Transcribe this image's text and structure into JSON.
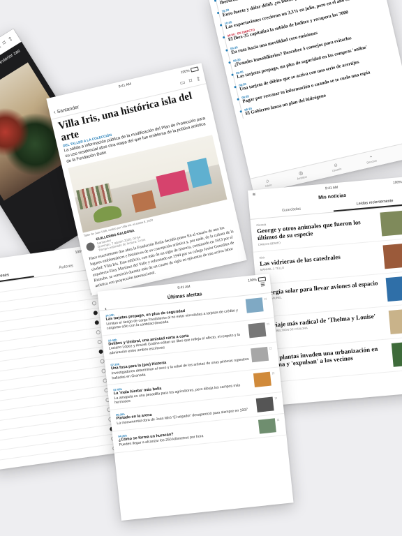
{
  "status": {
    "time": "9:41 AM",
    "battery": "100%"
  },
  "dark_article": {
    "text": "del Dolce undo que se ños. Los el exterior zas y cucharas"
  },
  "article": {
    "back_label": "Santander",
    "title": "Villa Iris, una histórica isla del arte",
    "kicker": "DEL TALLER A LA COLECCIÓN",
    "lead": "La salida a información pública de la modificación del Plan de Protección para su uso residencial abre otra etapa del que fue emblema de la política artística de la Fundación Botín",
    "caption": "Taller de Juan Uslé, cedido por Villa Iris, el artista 8, 2020",
    "author": "GUILLERMO BALBONA",
    "author_location": "Santander",
    "date": "Domingo, 7 agosto 2020, 00:54",
    "reading_time": "Tiempo estimado de lectura: 3 min",
    "body": "Hace exactamente dos años la Fundación Botín decidió poner fin al rosario de una los lugares emblemáticos e históricos de su concepción artística y, por ende, de la cultura de la ciudad: Villa Iris. Este edificio, con más de un siglo de historia, construido en 1913 por el arquitecto Eloy Martínez del Valle y reformado en 1944 por su colega Javier González de Riancho, se convirtió durante más de un cuarto de siglo en epicentro de una activa labor artística con proyección internacional."
  },
  "timeline": {
    "items": [
      {
        "time": "10:35",
        "title": "Iberdrola desembarca con un proyecto eólico marino"
      },
      {
        "time": "10:20",
        "title": "Euro fuerte y dólar débil: ¿es bueno para la economía europea?"
      },
      {
        "time": "10:05",
        "title": "Las exportaciones crecieron un 3,3% en julio, pero en el año caen un 14,6%"
      },
      {
        "time": "09:50 · EN DIRECTO",
        "title": "El Ibex-35 capitaliza la subida de Inditex y recupera los 7000"
      },
      {
        "time": "09:35",
        "title": "En ruta hacia una movilidad cero emisiones"
      },
      {
        "time": "09:20",
        "title": "¿Fraudes inmobiliarios? Descubre 5 consejos para evitarlos"
      },
      {
        "time": "09:05",
        "title": "Las tarjetas prepago, un plus de seguridad en las compras 'online'"
      },
      {
        "time": "08:50",
        "title": "Una tarjeta de débito que se activa con una serie de acertijos"
      },
      {
        "time": "08:35",
        "title": "Pagar por rescatar tu información o cuando se te cuela una espía"
      },
      {
        "time": "08:20",
        "title": "El Gobierno lanza un plan del hidrógeno"
      }
    ],
    "tabbar": [
      {
        "icon": "home-icon",
        "label": "Inicio"
      },
      {
        "icon": "globe-icon",
        "label": "Ámbitos"
      },
      {
        "icon": "user-icon",
        "label": "Usuario"
      },
      {
        "icon": "clock-icon",
        "label": "Directos"
      },
      {
        "icon": "menu-icon",
        "label": "Menú"
      }
    ]
  },
  "mis_noticias": {
    "title": "Mis noticias",
    "tabs": [
      "Guardadas",
      "Leídas recientemente"
    ],
    "items": [
      {
        "section": "Ciencia",
        "title": "George y otros animales que fueron los últimos de su especie",
        "author": "Carlos Benito",
        "thumb": "#7f8a5b"
      },
      {
        "section": "Vivir",
        "title": "Las vidrieras de las catedrales",
        "author": "Manuel J. Tello",
        "thumb": "#9b5a3a"
      },
      {
        "section": "",
        "title": "Energía solar para llevar aviones al espacio",
        "author": "R. Rosaurel",
        "thumb": "#2f6fa8"
      },
      {
        "section": "",
        "title": "El viaje más radical de 'Thelma y Louise'",
        "author": "Óscar Beltrán de Otálora",
        "thumb": "#c9b38a"
      },
      {
        "section": "",
        "title": "Las plantas invaden una urbanización en China y 'expulsan' a los vecinos",
        "author": "",
        "thumb": "#3e6b3a"
      }
    ]
  },
  "lista": {
    "tabs": [
      "Intereses",
      "Autores"
    ],
    "rows": [
      false,
      true,
      false,
      false,
      true,
      true,
      false,
      false,
      true,
      false,
      false,
      false,
      false,
      false,
      false,
      false,
      true,
      false,
      false,
      false
    ]
  },
  "alertas": {
    "title": "Últimas alertas",
    "items": [
      {
        "time": "14:15h",
        "title": "Las tarjetas prepago, un plus de seguridad",
        "desc": "Limitan el riesgo de cargo fraudulento al no estar vinculadas a tarjetas de crédito y cargarse sólo con la cantidad deseada",
        "thumb": "#7fa9c4"
      },
      {
        "time": "10:40h",
        "title": "Delibes y Umbral, una amistad carta a carta",
        "desc": "Luciano López y Araceli Godino editan un libro que refleja el afecto, el respeto y la admiración entre ambos escritores",
        "thumb": "#777"
      },
      {
        "time": "07:30h",
        "title": "Una fosa para la (pre) Historia",
        "desc": "Investigadores determinan el sexo y la edad de los artistas de unas pinturas rupestres halladas en Granada",
        "thumb": "#a7a7a7"
      },
      {
        "time": "07:00h",
        "title": "La 'mala hierba' más bella",
        "desc": "La amapola es una pesadilla para los agricultores, pero dibuja los campos más hermosos",
        "thumb": "#d08a3a"
      },
      {
        "time": "06:30h",
        "title": "Pintado en la arena",
        "desc": "La monumental obra de Joan Miró 'El segador' desapareció para siempre en 1937",
        "thumb": "#555"
      },
      {
        "time": "04:20h",
        "title": "¿Cómo se forma un huracán?",
        "desc": "Pueden llegar a alcanzar los 250 kilómetros por hora",
        "thumb": "#6f8e6f"
      }
    ]
  }
}
